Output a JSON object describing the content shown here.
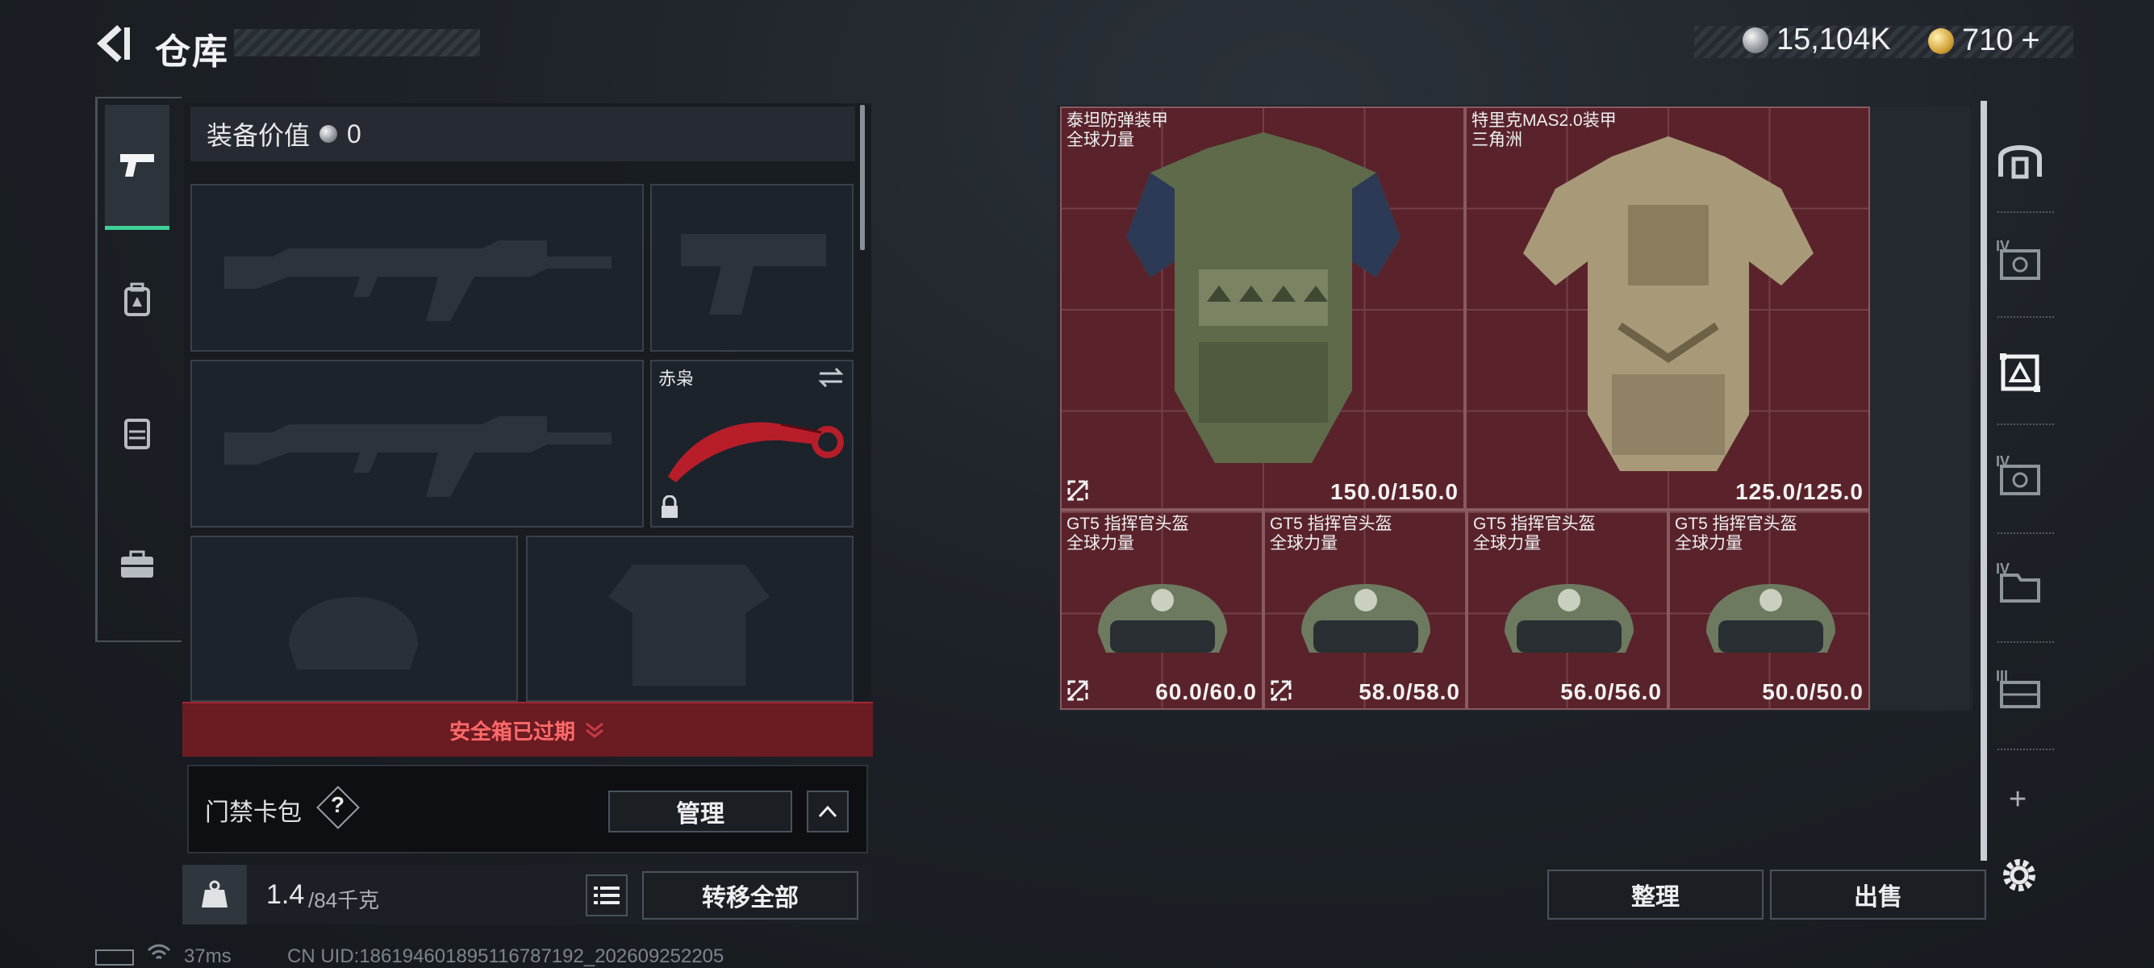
{
  "header": {
    "title": "仓库",
    "currency_silver": "15,104K",
    "currency_gold": "710",
    "gold_add": "+"
  },
  "loadout": {
    "value_label": "装备价值",
    "value": "0",
    "knife_name": "赤枭",
    "safebox_status": "安全箱已过期",
    "keycard_label": "门禁卡包",
    "keycard_help": "?",
    "manage_button": "管理",
    "weight_current": "1.4",
    "weight_max": "/84千克",
    "weight_unit_badge": "KG",
    "transfer_all_button": "转移全部"
  },
  "stash": {
    "items": [
      {
        "name": "泰坦防弹装甲",
        "sub": "全球力量",
        "durability": "150.0/150.0"
      },
      {
        "name": "特里克MAS2.0装甲",
        "sub": "三角洲",
        "durability": "125.0/125.0"
      },
      {
        "name": "GT5 指挥官头盔",
        "sub": "全球力量",
        "durability": "60.0/60.0"
      },
      {
        "name": "GT5 指挥官头盔",
        "sub": "全球力量",
        "durability": "58.0/58.0"
      },
      {
        "name": "GT5 指挥官头盔",
        "sub": "全球力量",
        "durability": "56.0/56.0"
      },
      {
        "name": "GT5 指挥官头盔",
        "sub": "全球力量",
        "durability": "50.0/50.0"
      }
    ],
    "sort_button": "整理",
    "sell_button": "出售",
    "add_icon": "+",
    "side_tier_labels": [
      "IV",
      "IV",
      "IV",
      "III"
    ]
  },
  "footer": {
    "ping": "37ms",
    "uid": "CN UID:1861946018951167871​92_202609252205"
  },
  "colors": {
    "accent": "#3fd19a",
    "expired_red": "#6b1b22",
    "grid_red": "#5a232b"
  }
}
